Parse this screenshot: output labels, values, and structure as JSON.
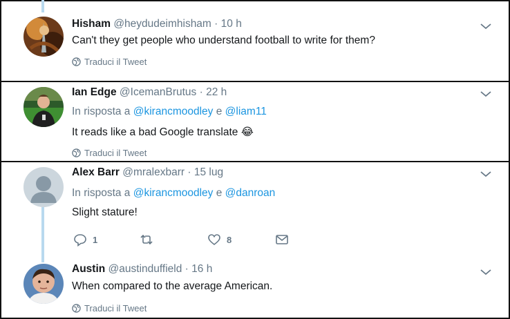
{
  "tweets": [
    {
      "name": "Hisham",
      "handle": "@heydudeimhisham",
      "dot": "·",
      "time": "10 h",
      "text": "Can't they get people who understand football to write for them?",
      "translate": "Traduci il Tweet"
    },
    {
      "name": "Ian Edge",
      "handle": "@IcemanBrutus",
      "dot": "·",
      "time": "22 h",
      "reply_prefix": "In risposta a",
      "reply_m1": "@kirancmoodley",
      "reply_and": "e",
      "reply_m2": "@liam11",
      "text": "It reads like a bad Google translate 😂",
      "translate": "Traduci il Tweet"
    },
    {
      "name": "Alex Barr",
      "handle": "@mralexbarr",
      "dot": "·",
      "time": "15 lug",
      "reply_prefix": "In risposta a",
      "reply_m1": "@kirancmoodley",
      "reply_and": "e",
      "reply_m2": "@danroan",
      "text": "Slight stature!",
      "reply_count": "1",
      "retweet_count": "",
      "like_count": "8"
    },
    {
      "name": "Austin",
      "handle": "@austinduffield",
      "dot": "·",
      "time": "16 h",
      "text": "When compared to the average American.",
      "translate": "Traduci il Tweet"
    }
  ],
  "colors": {
    "link": "#1b95e0",
    "muted": "#657786",
    "thread_line": "#b9d9ef"
  },
  "icons": [
    "globe-icon",
    "chevron-down-icon",
    "reply-icon",
    "retweet-icon",
    "like-icon",
    "direct-message-icon"
  ]
}
